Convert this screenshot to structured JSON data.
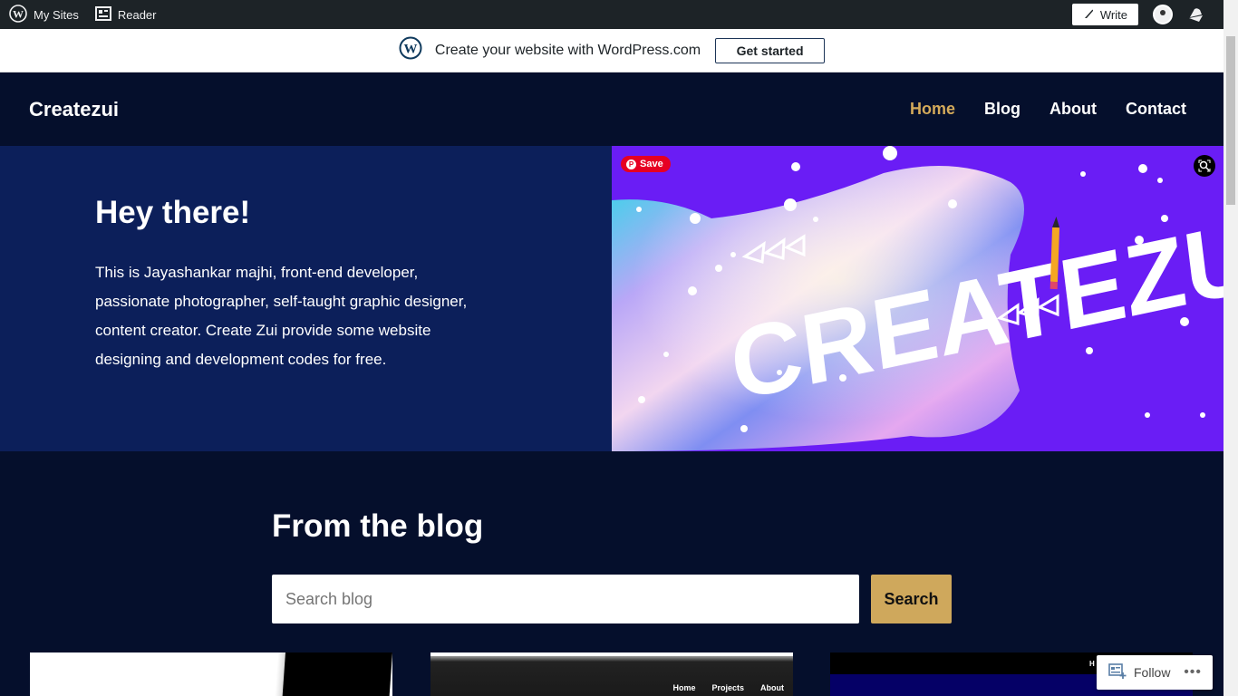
{
  "adminbar": {
    "my_sites": "My Sites",
    "reader": "Reader",
    "write": "Write"
  },
  "promo": {
    "text": "Create your website with WordPress.com",
    "button": "Get started"
  },
  "header": {
    "site_title": "Createzui",
    "nav": [
      {
        "label": "Home",
        "active": true
      },
      {
        "label": "Blog",
        "active": false
      },
      {
        "label": "About",
        "active": false
      },
      {
        "label": "Contact",
        "active": false
      }
    ],
    "accent_color": "#d4aa5a"
  },
  "hero": {
    "title": "Hey there!",
    "text": "This is Jayashankar majhi, front-end developer, passionate photographer, self-taught graphic designer, content creator. Create Zui provide some website designing and development codes for free.",
    "image_text": "CREATEZU",
    "pinterest_save": "Save"
  },
  "blog": {
    "title": "From the blog",
    "search_placeholder": "Search blog",
    "search_button": "Search",
    "button_color": "#cfa85c",
    "card2_menu": [
      "Home",
      "Projects",
      "About"
    ],
    "card3_label": "H"
  },
  "follow": {
    "label": "Follow",
    "more": "•••"
  },
  "icons": [
    "wordpress-icon",
    "reader-icon",
    "pen-icon",
    "avatar",
    "bell-icon",
    "pinterest-icon",
    "lens-icon",
    "follow-icon",
    "more-icon"
  ]
}
